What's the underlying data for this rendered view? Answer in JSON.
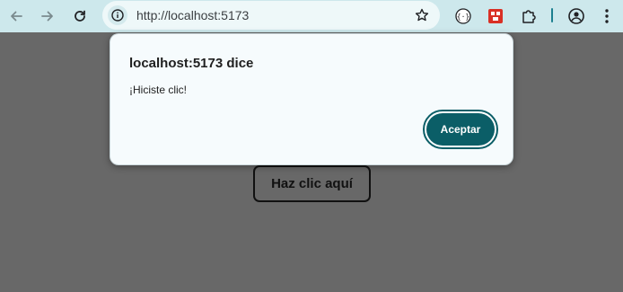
{
  "browser": {
    "url": "http://localhost:5173",
    "colors": {
      "toolbar": "#cde8ec",
      "omnibox": "#eef8f9",
      "accent": "#1b7f8f"
    },
    "icons": {
      "back": "back-arrow-icon",
      "forward": "forward-arrow-icon",
      "reload": "reload-icon",
      "info": "site-info-icon",
      "bookmark": "star-icon",
      "extension_1": "code-brackets-extension-icon",
      "extension_2": "red-extension-icon",
      "extensions": "puzzle-icon",
      "profile": "profile-icon",
      "menu": "kebab-menu-icon"
    }
  },
  "page": {
    "background": "#686868",
    "button_label": "Haz clic aquí"
  },
  "dialog": {
    "title": "localhost:5173 dice",
    "message": "¡Hiciste clic!",
    "ok_label": "Aceptar",
    "ok_color": "#0b5e67"
  }
}
